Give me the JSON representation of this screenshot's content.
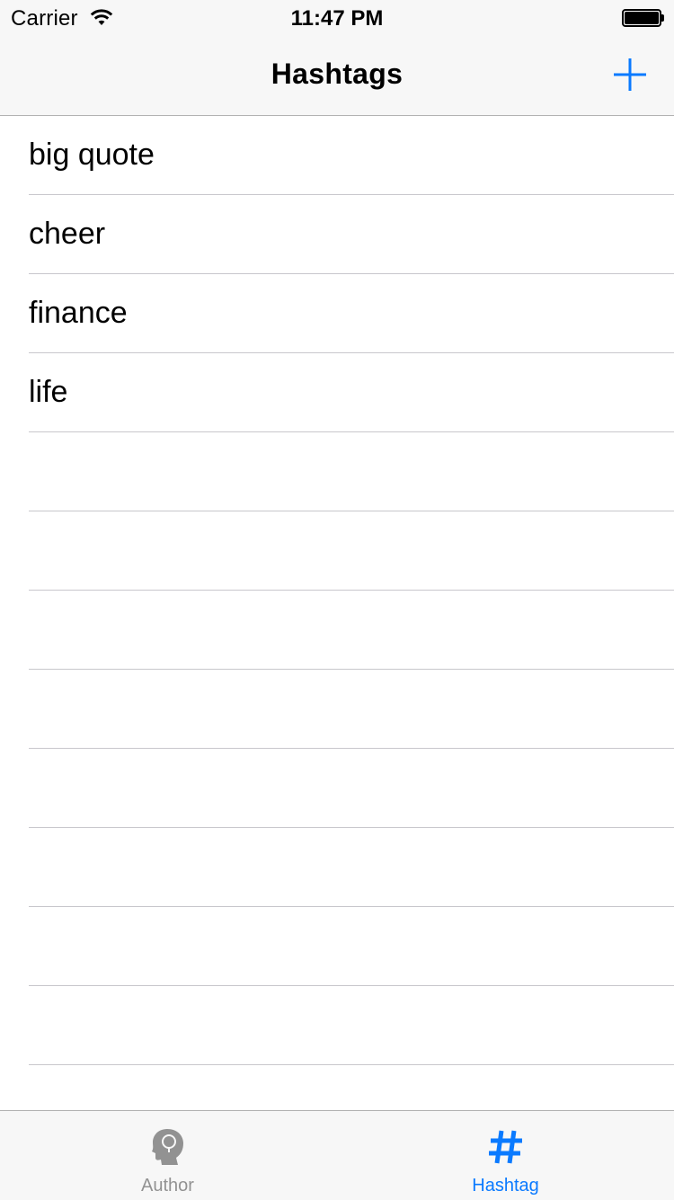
{
  "status_bar": {
    "carrier": "Carrier",
    "time": "11:47 PM",
    "wifi_icon": "wifi-icon",
    "battery_icon": "battery-icon"
  },
  "nav": {
    "title": "Hashtags",
    "add_icon": "plus-icon",
    "accent_color": "#0a7aff"
  },
  "hashtags": [
    "big quote",
    "cheer",
    "finance",
    "life"
  ],
  "tabs": [
    {
      "label": "Author",
      "icon": "head-silhouette-icon",
      "selected": false,
      "color": "#929292"
    },
    {
      "label": "Hashtag",
      "icon": "hash-icon",
      "selected": true,
      "color": "#0a7aff"
    }
  ]
}
